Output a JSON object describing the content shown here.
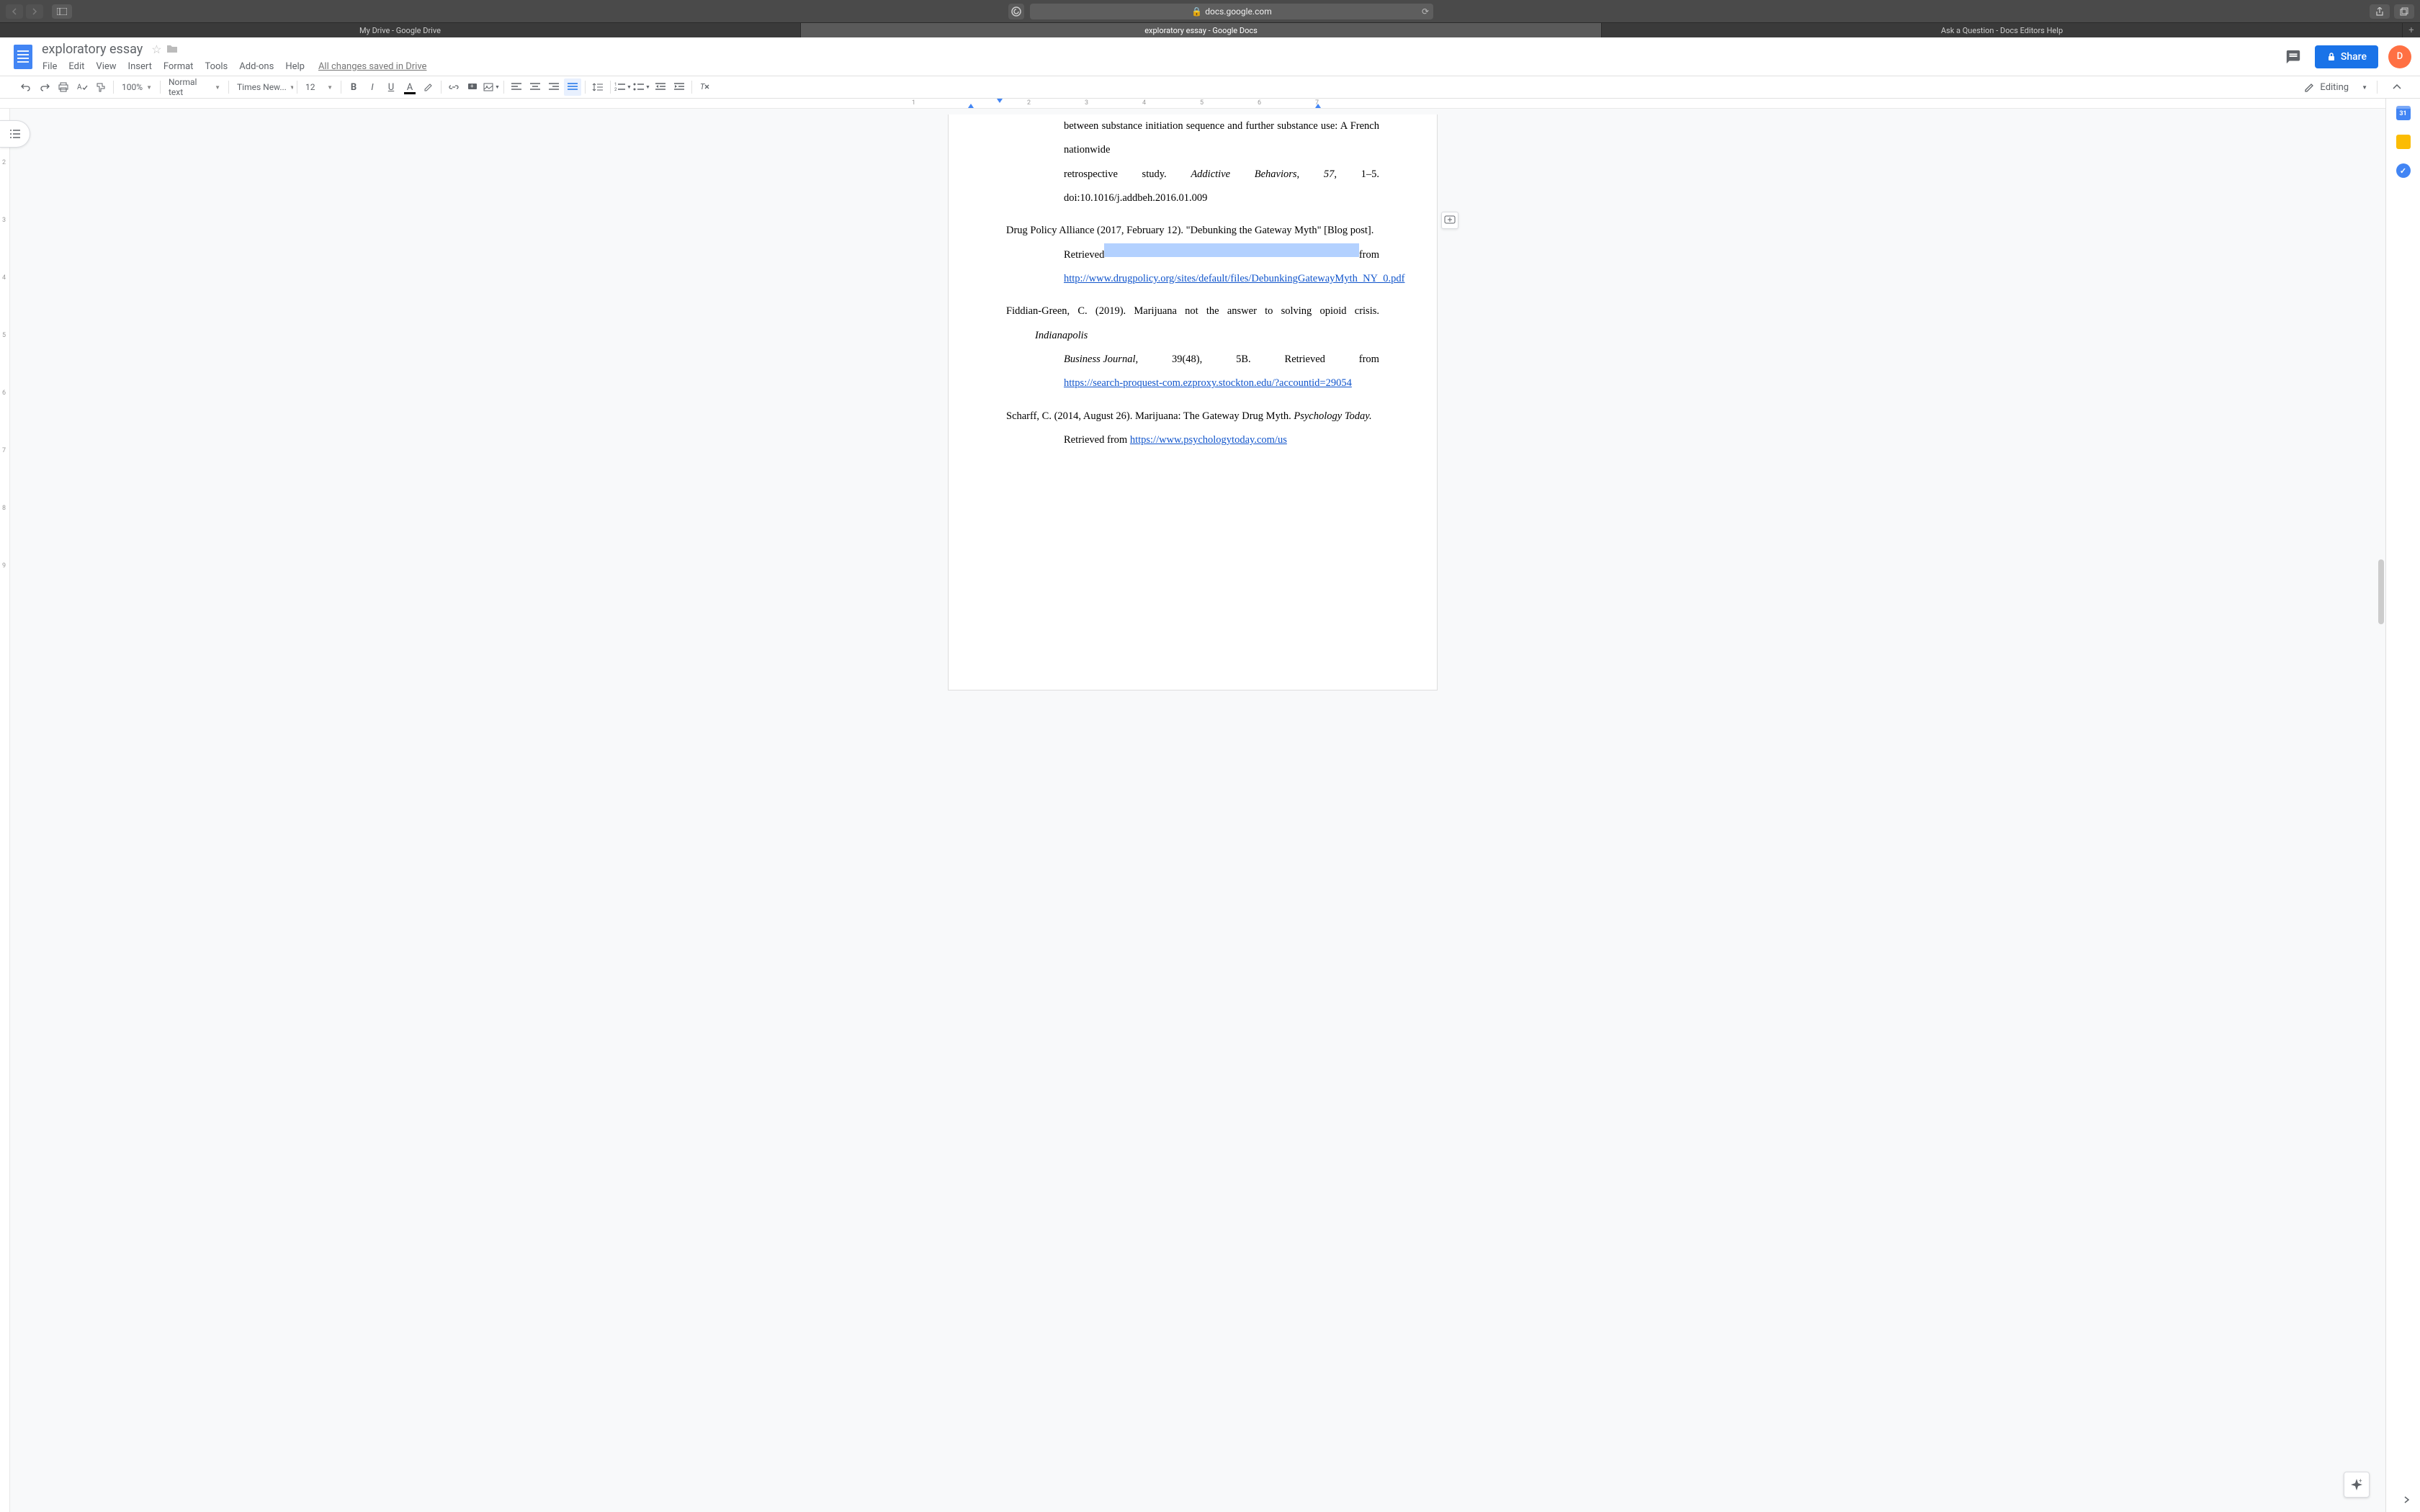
{
  "browser": {
    "url_display": "docs.google.com",
    "tabs": [
      "My Drive - Google Drive",
      "exploratory essay - Google Docs",
      "Ask a Question - Docs Editors Help"
    ],
    "active_tab_index": 1
  },
  "doc": {
    "title": "exploratory essay",
    "save_status": "All changes saved in Drive",
    "avatar_letter": "D"
  },
  "menus": [
    "File",
    "Edit",
    "View",
    "Insert",
    "Format",
    "Tools",
    "Add-ons",
    "Help"
  ],
  "toolbar": {
    "zoom": "100%",
    "style": "Normal text",
    "font": "Times New...",
    "size": "12",
    "editing_mode": "Editing",
    "share_label": "Share"
  },
  "ruler": {
    "h_marks": [
      "1",
      "2",
      "3",
      "4",
      "5",
      "6",
      "7"
    ],
    "v_marks": [
      "2",
      "3",
      "4",
      "5",
      "6",
      "7",
      "8",
      "9"
    ]
  },
  "references": {
    "entry1": {
      "line1": "between  substance  initiation  sequence  and  further  substance  use:  A  French  nationwide",
      "line2_a": "retrospective study. ",
      "line2_italic": "Addictive Behaviors",
      "line2_b": ", ",
      "line2_vol": "57",
      "line2_c": ", 1–5. doi:10.1016/j.addbeh.2016.01.009"
    },
    "entry2": {
      "line1": "Drug  Policy  Alliance  (2017,  February  12).  \"Debunking  the  Gateway  Myth\"  [Blog  post].",
      "line2_a": "Retrieved",
      "line2_b": "from",
      "url": "http://www.drugpolicy.org/sites/default/files/DebunkingGatewayMyth_NY_0.pdf"
    },
    "entry3": {
      "line1_a": "Fiddian-Green,  C.  (2019).  Marijuana  not  the  answer  to  solving  opioid  crisis.  ",
      "line1_italic": "Indianapolis",
      "line2_italic": "Business        Journal,",
      "line2_a": "        39(48),        5B.        Retrieved        from",
      "url": "https://search-proquest-com.ezproxy.stockton.edu/?accountid=29054"
    },
    "entry4": {
      "line1_a": "Scharff,  C.  (2014,  August  26).  Marijuana:  The  Gateway  Drug  Myth.  ",
      "line1_italic": "Psychology  Today.",
      "line2_a": "Retrieved from ",
      "url": "https://www.psychologytoday.com/us"
    }
  }
}
